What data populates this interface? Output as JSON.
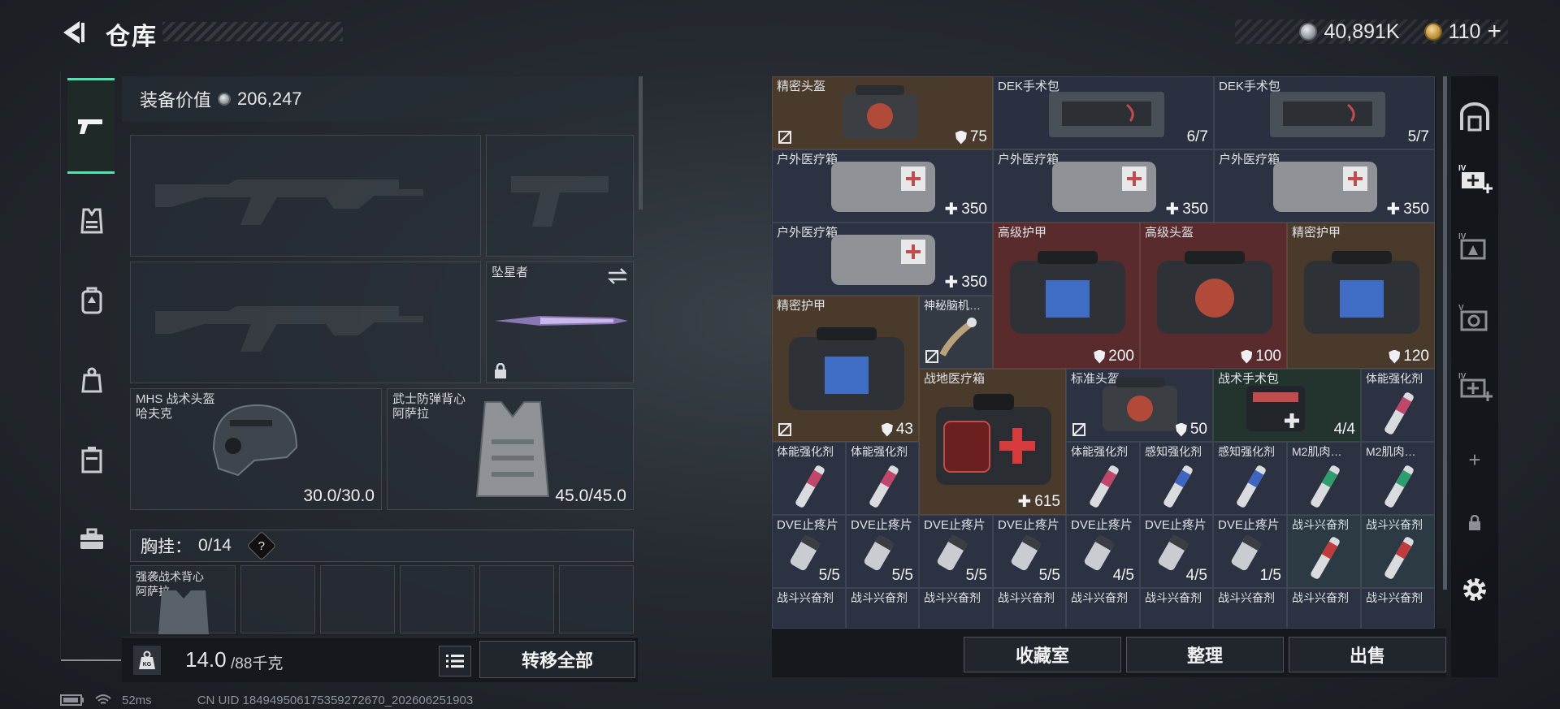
{
  "header": {
    "title": "仓库",
    "currency_silver": "40,891K",
    "currency_gold": "110",
    "gold_plus": "+"
  },
  "nav": {
    "items": [
      {
        "name": "pistol-icon"
      },
      {
        "name": "vest-icon"
      },
      {
        "name": "backpack-icon"
      },
      {
        "name": "pouch-icon"
      },
      {
        "name": "case-icon"
      },
      {
        "name": "toolbox-icon"
      }
    ]
  },
  "loadout": {
    "equip_value_label": "装备价值",
    "equip_value": "206,247",
    "melee_label": "坠星者",
    "helmet": {
      "label": "MHS 战术头盔\n哈夫克",
      "value": "30.0/30.0"
    },
    "armor": {
      "label": "武士防弹背心\n阿萨拉",
      "value": "45.0/45.0"
    },
    "chest_rig_label": "胸挂：",
    "chest_rig_value": "0/14",
    "chest_rig_help": "?",
    "rig_item_label": "强袭战术背心\n阿萨拉",
    "weight": "14.0",
    "weight_max": "/88千克",
    "weight_icon_text": "KG",
    "transfer_all": "转移全部"
  },
  "inventory": {
    "rows": [
      [
        {
          "name": "精密头盔",
          "val": "75",
          "kind": "shield",
          "nodrop": true,
          "span": 2,
          "bg": "#4a3a2c",
          "thumb": "bag-red"
        },
        {
          "name": "DEK手术包",
          "val": "6/7",
          "kind": "plain",
          "span": 2,
          "bg": "#2b3040",
          "thumb": "kit"
        },
        {
          "name": "DEK手术包",
          "val": "5/7",
          "kind": "plain",
          "span": 2,
          "bg": "#2b3040",
          "thumb": "kit"
        }
      ],
      [
        {
          "name": "户外医疗箱",
          "val": "350",
          "kind": "plus",
          "span": 2,
          "bg": "#2d3242",
          "thumb": "box"
        },
        {
          "name": "户外医疗箱",
          "val": "350",
          "kind": "plus",
          "span": 2,
          "bg": "#2d3242",
          "thumb": "box"
        },
        {
          "name": "户外医疗箱",
          "val": "350",
          "kind": "plus",
          "span": 2,
          "bg": "#2d3242",
          "thumb": "box"
        }
      ]
    ],
    "cells": [
      {
        "name": "户外医疗箱",
        "val": "350",
        "kind": "plus"
      },
      {
        "name": "高级护甲",
        "val": "200",
        "kind": "shield"
      },
      {
        "name": "高级头盔",
        "val": "100",
        "kind": "shield"
      },
      {
        "name": "精密护甲",
        "val": "120",
        "kind": "shield"
      },
      {
        "name": "精密护甲",
        "val": "43",
        "kind": "shield"
      },
      {
        "name": "神秘脑机…",
        "val": ""
      },
      {
        "name": "战地医疗箱",
        "val": "615",
        "kind": "plus"
      },
      {
        "name": "标准头盔",
        "val": "50",
        "kind": "shield"
      },
      {
        "name": "战术手术包",
        "val": "4/4",
        "kind": "plain"
      },
      {
        "name": "体能强化剂",
        "val": ""
      },
      {
        "name": "体能强化剂",
        "val": ""
      },
      {
        "name": "体能强化剂",
        "val": ""
      },
      {
        "name": "体能强化剂",
        "val": ""
      },
      {
        "name": "感知强化剂",
        "val": ""
      },
      {
        "name": "感知强化剂",
        "val": ""
      },
      {
        "name": "M2肌肉…",
        "val": ""
      },
      {
        "name": "M2肌肉…",
        "val": ""
      },
      {
        "name": "DVE止疼片",
        "val": "5/5"
      },
      {
        "name": "DVE止疼片",
        "val": "5/5"
      },
      {
        "name": "DVE止疼片",
        "val": "5/5"
      },
      {
        "name": "DVE止疼片",
        "val": "5/5"
      },
      {
        "name": "DVE止疼片",
        "val": "4/5"
      },
      {
        "name": "DVE止疼片",
        "val": "4/5"
      },
      {
        "name": "DVE止疼片",
        "val": "1/5"
      },
      {
        "name": "战斗兴奋剂",
        "val": ""
      },
      {
        "name": "战斗兴奋剂",
        "val": ""
      },
      {
        "name": "战斗兴奋剂",
        "val": ""
      }
    ],
    "bottom_row_label": "战斗兴奋剂"
  },
  "right_strip": {
    "items": [
      "safe-icon",
      "container-iv-add-icon",
      "container-iv-icon",
      "container-v-icon",
      "container-iv-add-2-icon",
      "add-icon",
      "lock-icon",
      "settings-icon"
    ]
  },
  "actions": {
    "collection": "收藏室",
    "organize": "整理",
    "sell": "出售"
  },
  "status": {
    "ping": "52ms",
    "uid": "CN UID 184949506175359272670_202606251903"
  },
  "colors": {
    "accent": "#4fe3b0",
    "cell_armor_red": "#5a2b2d",
    "cell_helmet_brown": "#4a3a2c",
    "cell_gray": "#343a44",
    "cell_green": "#23342f"
  }
}
